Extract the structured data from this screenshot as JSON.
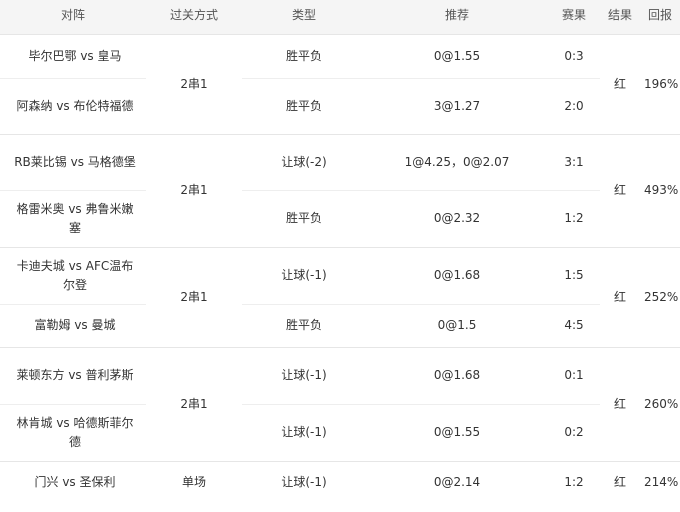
{
  "headers": {
    "match": "对阵",
    "mode": "过关方式",
    "type": "类型",
    "pick": "推荐",
    "score": "赛果",
    "result": "结果",
    "return": "回报"
  },
  "groups": [
    {
      "mode": "2串1",
      "result": "红",
      "return": "196%",
      "legs": [
        {
          "match": "毕尔巴鄂 vs 皇马",
          "type": "胜平负",
          "pick": "0@1.55",
          "score": "0:3"
        },
        {
          "match": "阿森纳 vs 布伦特福德",
          "type": "胜平负",
          "pick": "3@1.27",
          "score": "2:0"
        }
      ]
    },
    {
      "mode": "2串1",
      "result": "红",
      "return": "493%",
      "legs": [
        {
          "match": "RB莱比锡 vs 马格德堡",
          "type": "让球(-2)",
          "pick": "1@4.25，0@2.07",
          "score": "3:1"
        },
        {
          "match": "格雷米奥 vs 弗鲁米嫩塞",
          "type": "胜平负",
          "pick": "0@2.32",
          "score": "1:2"
        }
      ]
    },
    {
      "mode": "2串1",
      "result": "红",
      "return": "252%",
      "legs": [
        {
          "match": "卡迪夫城 vs AFC温布尔登",
          "type": "让球(-1)",
          "pick": "0@1.68",
          "score": "1:5"
        },
        {
          "match": "富勒姆 vs 曼城",
          "type": "胜平负",
          "pick": "0@1.5",
          "score": "4:5"
        }
      ]
    },
    {
      "mode": "2串1",
      "result": "红",
      "return": "260%",
      "legs": [
        {
          "match": "莱顿东方 vs 普利茅斯",
          "type": "让球(-1)",
          "pick": "0@1.68",
          "score": "0:1"
        },
        {
          "match": "林肯城 vs 哈德斯菲尔德",
          "type": "让球(-1)",
          "pick": "0@1.55",
          "score": "0:2"
        }
      ]
    },
    {
      "mode": "单场",
      "result": "红",
      "return": "214%",
      "legs": [
        {
          "match": "门兴 vs 圣保利",
          "type": "让球(-1)",
          "pick": "0@2.14",
          "score": "1:2"
        }
      ]
    }
  ]
}
